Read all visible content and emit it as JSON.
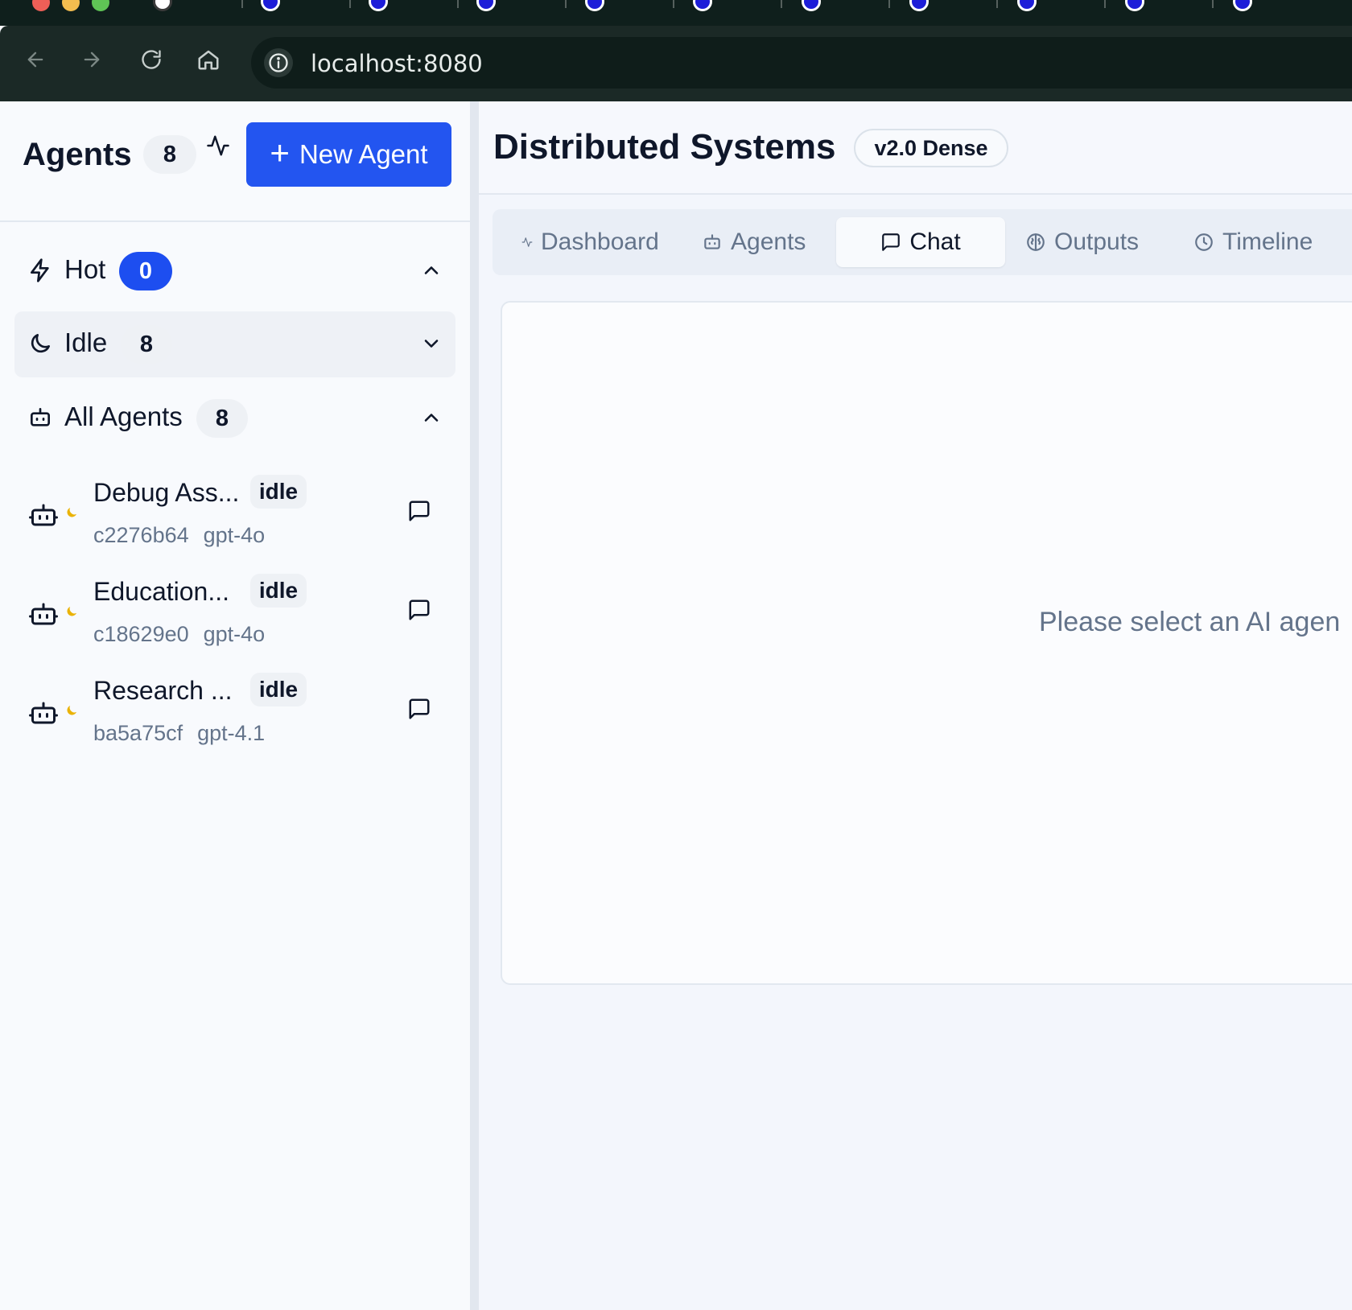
{
  "browser": {
    "url": "localhost:8080"
  },
  "sidebar": {
    "title": "Agents",
    "count": "8",
    "new_agent_label": "New Agent",
    "groups": [
      {
        "label": "Hot",
        "count": "0",
        "icon": "zap-icon",
        "expanded": true
      },
      {
        "label": "Idle",
        "count": "8",
        "icon": "moon-icon",
        "expanded": false
      },
      {
        "label": "All Agents",
        "count": "8",
        "icon": "bot-icon",
        "expanded": true
      }
    ],
    "agents": [
      {
        "name": "Debug Ass...",
        "state": "idle",
        "id": "c2276b64",
        "model": "gpt-4o"
      },
      {
        "name": "Education...",
        "state": "idle",
        "id": "c18629e0",
        "model": "gpt-4o"
      },
      {
        "name": "Research ...",
        "state": "idle",
        "id": "ba5a75cf",
        "model": "gpt-4.1"
      }
    ]
  },
  "main": {
    "title": "Distributed Systems",
    "version": "v2.0 Dense",
    "tabs": [
      {
        "label": "Dashboard",
        "icon": "activity-icon"
      },
      {
        "label": "Agents",
        "icon": "bot-icon"
      },
      {
        "label": "Chat",
        "icon": "message-square-icon",
        "active": true
      },
      {
        "label": "Outputs",
        "icon": "brain-icon"
      },
      {
        "label": "Timeline",
        "icon": "clock-icon"
      }
    ],
    "empty_message": "Please select an AI agen"
  },
  "colors": {
    "primary": "#2355f0",
    "hot_badge": "#1d4ef0",
    "idle_moon": "#eab308",
    "chrome_dark": "#1b2926"
  }
}
